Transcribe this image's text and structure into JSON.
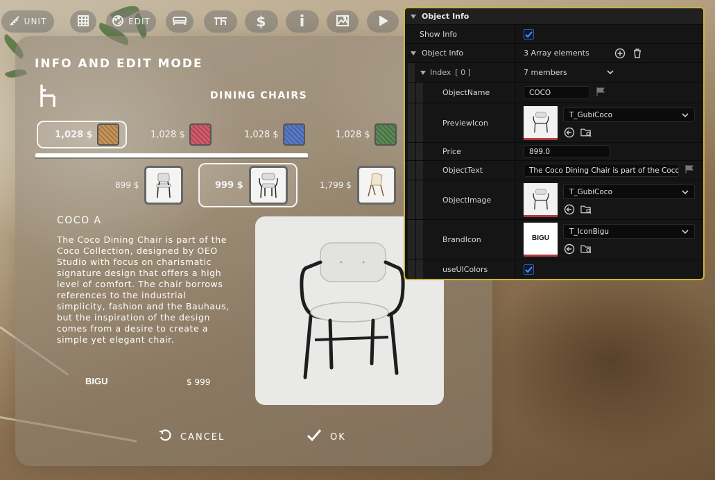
{
  "toolbar": {
    "unit_label": "UNIT",
    "edit_label": "EDIT",
    "buttons": [
      "unit",
      "grid",
      "edit",
      "sofa",
      "layout",
      "dollar",
      "info",
      "image",
      "play"
    ]
  },
  "panel": {
    "title": "INFO AND EDIT MODE",
    "category": "DINING CHAIRS",
    "variants": [
      {
        "price": "1,028 $",
        "color": "#c8955a",
        "selected": true
      },
      {
        "price": "1,028 $",
        "color": "#d55a6a",
        "selected": false
      },
      {
        "price": "1,028 $",
        "color": "#5a7ac8",
        "selected": false
      },
      {
        "price": "1,028 $",
        "color": "#5a8a55",
        "selected": false
      }
    ],
    "products": [
      {
        "price": "899 $",
        "selected": false
      },
      {
        "price": "999 $",
        "selected": true
      },
      {
        "price": "1,799 $",
        "selected": false
      }
    ],
    "product_name": "COCO A",
    "description": "The Coco Dining Chair is part of the Coco Collection, designed by OEO Studio with focus on charismatic signature design that offers a high level of comfort. The chair borrows references to the industrial simplicity, fashion and the Bauhaus, but the inspiration of the design comes from a desire to create a simple yet elegant chair.",
    "brand": "BIGU",
    "price": "$ 999",
    "cancel_label": "CANCEL",
    "ok_label": "OK"
  },
  "details": {
    "header": "Object Info",
    "show_info_label": "Show Info",
    "show_info_checked": true,
    "object_info_label": "Object Info",
    "array_elements": "3 Array elements",
    "index_label": "Index",
    "index_value": "[ 0 ]",
    "members": "7 members",
    "rows": {
      "object_name": {
        "label": "ObjectName",
        "value": "COCO"
      },
      "preview_icon": {
        "label": "PreviewIcon",
        "asset": "T_GubiCoco"
      },
      "price": {
        "label": "Price",
        "value": "899.0"
      },
      "object_text": {
        "label": "ObjectText",
        "value": "The Coco Dining Chair is part of the Coco"
      },
      "object_image": {
        "label": "ObjectImage",
        "asset": "T_GubiCoco"
      },
      "brand_icon": {
        "label": "BrandIcon",
        "asset": "T_IconBigu",
        "thumb_text": "BIGU"
      },
      "use_ui_colors": {
        "label": "useUIColors",
        "checked": true
      }
    }
  },
  "colors": {
    "accent_border": "#c8b63a",
    "checkbox": "#2d5aa8"
  }
}
